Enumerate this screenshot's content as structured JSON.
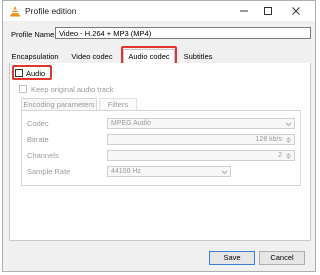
{
  "window": {
    "title": "Profile edition"
  },
  "profile": {
    "label": "Profile Name",
    "value": "Video - H.264 + MP3 (MP4)"
  },
  "tabs": [
    {
      "label": "Encapsulation"
    },
    {
      "label": "Video codec"
    },
    {
      "label": "Audio codec"
    },
    {
      "label": "Subtitles"
    }
  ],
  "audio": {
    "checkbox_label": "Audio",
    "keep_original_label": "Keep original audio track"
  },
  "subtabs": [
    {
      "label": "Encoding parameters"
    },
    {
      "label": "Filters"
    }
  ],
  "fields": {
    "codec_label": "Codec",
    "codec_value": "MPEG Audio",
    "bitrate_label": "Bitrate",
    "bitrate_value": "128 kb/s",
    "channels_label": "Channels",
    "channels_value": "2",
    "samplerate_label": "Sample Rate",
    "samplerate_value": "44100 Hz"
  },
  "buttons": {
    "save": "Save",
    "cancel": "Cancel"
  },
  "colors": {
    "highlight": "#e0362b",
    "accent": "#3c7fd6"
  },
  "icons": {
    "app": "vlc-cone-icon"
  }
}
